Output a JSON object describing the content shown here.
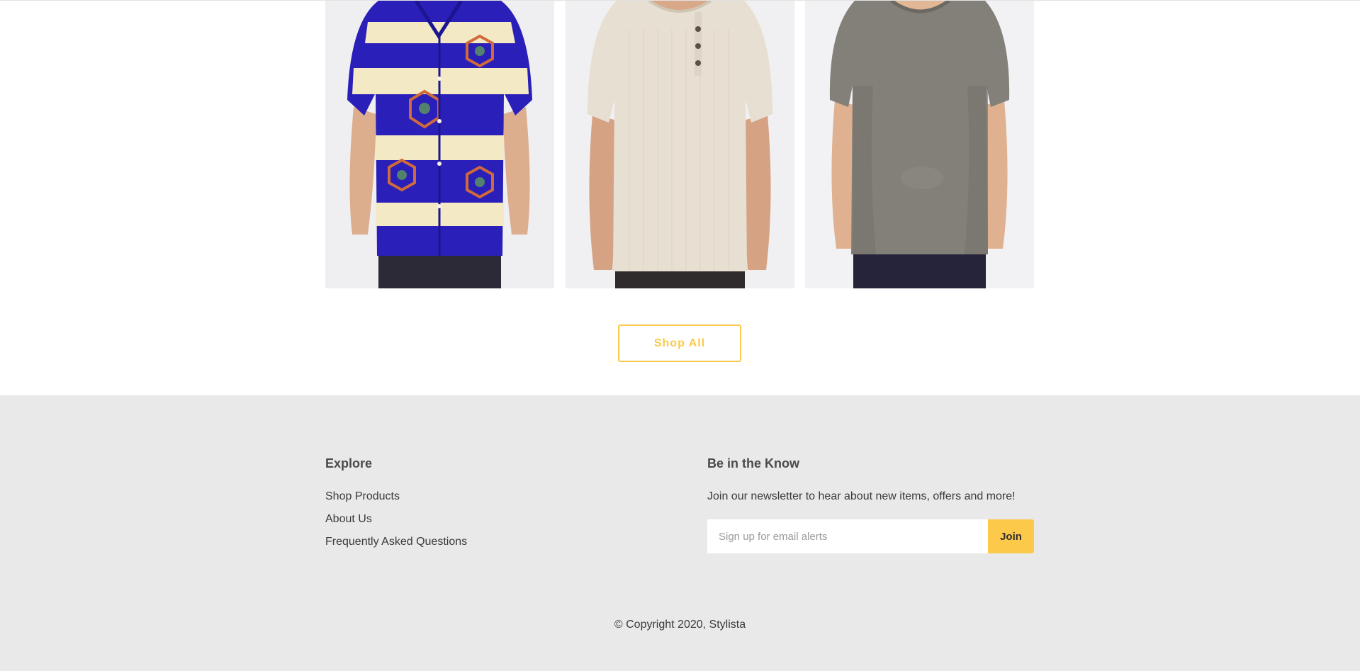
{
  "products": [
    {
      "image_desc": "Man wearing blue and cream crane-print short sleeve button shirt",
      "shirt_color": "#2a1fb8",
      "accent_color": "#f3e9c4"
    },
    {
      "image_desc": "Man wearing oatmeal henley t-shirt",
      "shirt_color": "#e7dfd2",
      "accent_color": "#d9cfbf"
    },
    {
      "image_desc": "Man wearing grey crewneck t-shirt",
      "shirt_color": "#838079",
      "accent_color": "#6f6c66"
    }
  ],
  "shop_all": {
    "label": "Shop All"
  },
  "footer": {
    "explore": {
      "heading": "Explore",
      "links": [
        "Shop Products",
        "About Us",
        "Frequently Asked Questions"
      ]
    },
    "newsletter": {
      "heading": "Be in the Know",
      "text": "Join our newsletter to hear about new items, offers and more!",
      "placeholder": "Sign up for email alerts",
      "button_label": "Join"
    },
    "copyright": "© Copyright 2020, Stylista"
  },
  "colors": {
    "accent": "#fdc94b",
    "footer_bg": "#e9e9e9",
    "image_bg": "#ececee"
  }
}
